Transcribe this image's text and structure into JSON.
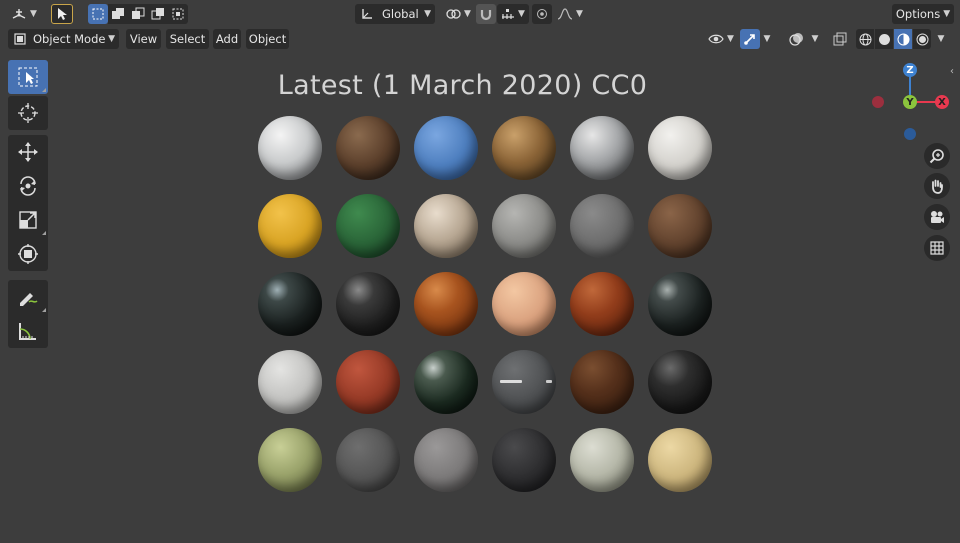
{
  "header": {
    "transform_orientation": "Global",
    "options_label": "Options"
  },
  "menubar": {
    "mode": "Object Mode",
    "menus": [
      "View",
      "Select",
      "Add",
      "Object"
    ]
  },
  "viewport": {
    "title": "Latest (1 March 2020) CC0",
    "gizmo": {
      "z": "Z",
      "y": "Y",
      "x": "X"
    }
  },
  "toolbar": {
    "tools": [
      "select-box",
      "cursor",
      "move",
      "rotate",
      "scale",
      "transform",
      "annotate",
      "measure"
    ]
  },
  "materials": [
    [
      "marble-white",
      "wood-rough",
      "fabric-blue",
      "rock-brown",
      "marble-veined",
      "plaster-white"
    ],
    [
      "fabric-yellow",
      "fabric-green",
      "marble-tan",
      "stone-gray",
      "concrete-gray",
      "wood-dark"
    ],
    [
      "granite-black-glossy",
      "plastic-black",
      "wood-polished-orange",
      "skin-tan",
      "wood-polished-red",
      "granite-black-glossy-2"
    ],
    [
      "concrete-white",
      "leather-red",
      "glass-dark-reflective",
      "asphalt-road",
      "wood-walnut",
      "rubber-black"
    ],
    [
      "moss-rock",
      "asphalt-gray",
      "fabric-gray",
      "leather-black",
      "tiles-pattern",
      "wood-barrel"
    ]
  ],
  "colors": {
    "bg": "#3d3d3d",
    "accent": "#4772b3",
    "axis_x": "#e8394f",
    "axis_y": "#8bc43d",
    "axis_z": "#3e82d1"
  }
}
